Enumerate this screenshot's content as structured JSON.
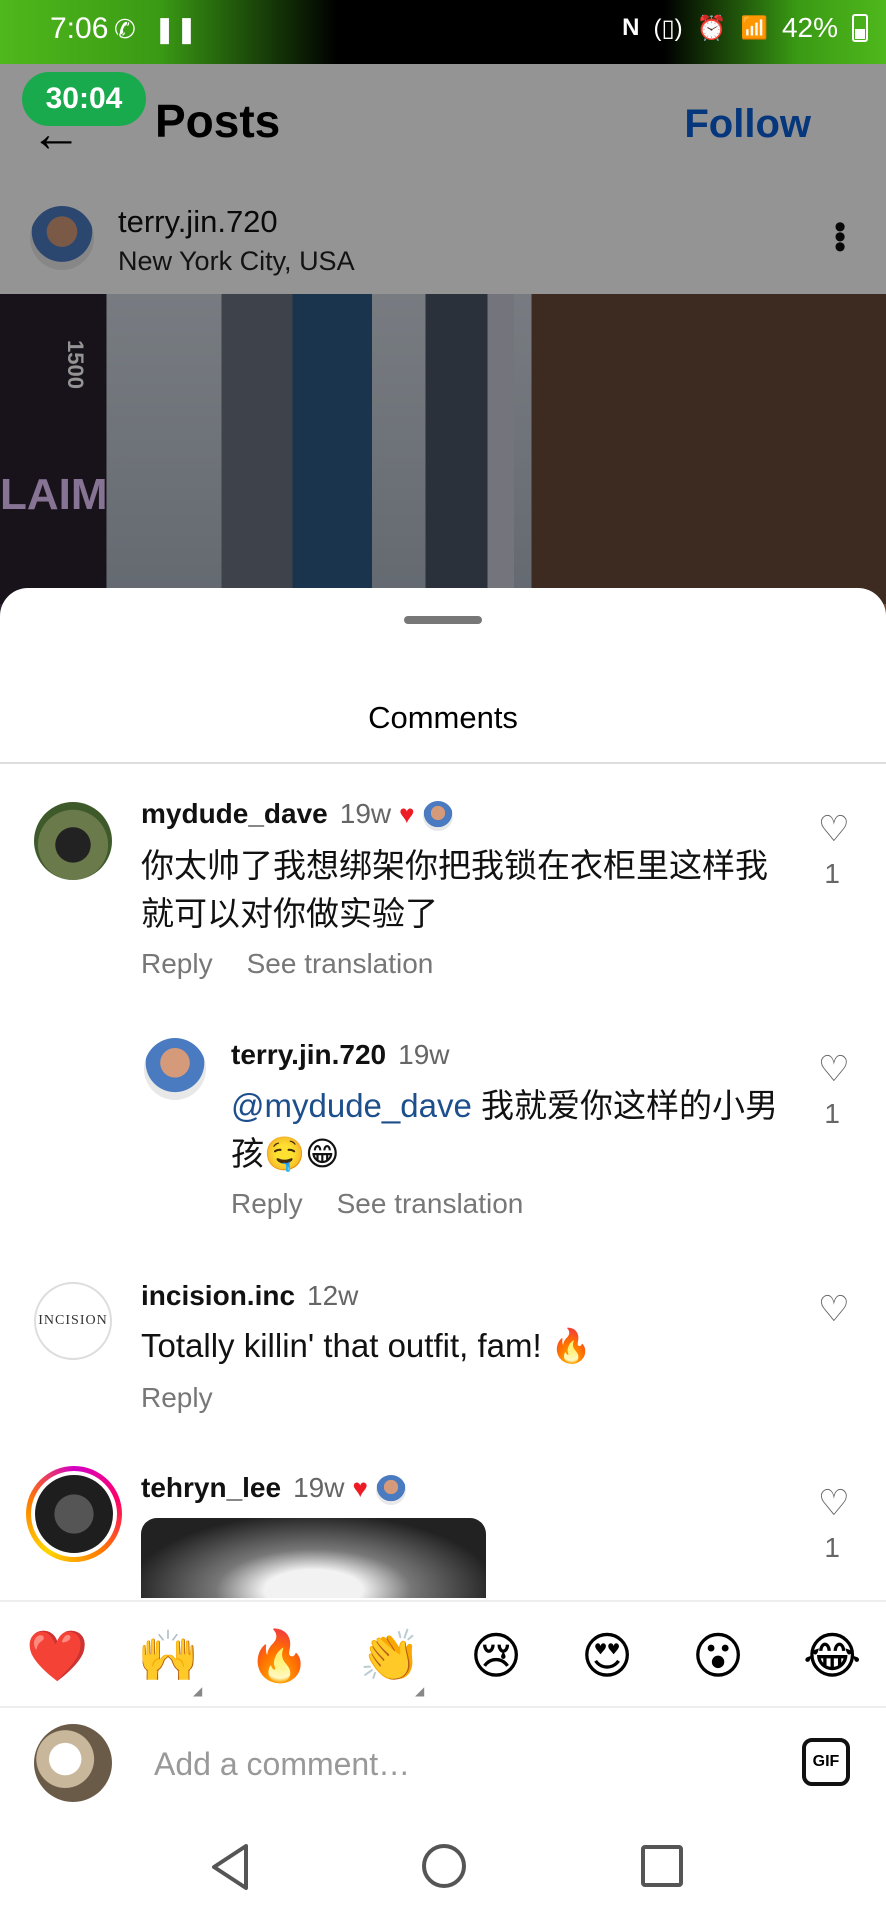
{
  "status_bar": {
    "time": "7:06",
    "battery": "42%",
    "left_icons": [
      "phone-icon",
      "pause-icon"
    ],
    "right_icons": [
      "nfc-icon",
      "vibrate-icon",
      "alarm-icon",
      "wifi-icon",
      "signal-icon",
      "battery-icon"
    ]
  },
  "timer": "30:04",
  "post_header": {
    "title": "Posts",
    "follow_label": "Follow",
    "username": "terry.jin.720",
    "location": "New York City, USA"
  },
  "post_image": {
    "sign_1500": "1500",
    "sign_claim": "LAIM"
  },
  "sheet": {
    "title": "Comments"
  },
  "comments": [
    {
      "user": "mydude_dave",
      "time": "19w",
      "liked_by_author": true,
      "text": "你太帅了我想绑架你把我锁在衣柜里这样我就可以对你做实验了",
      "reply_label": "Reply",
      "translate_label": "See translation",
      "likes": "1"
    },
    {
      "user": "terry.jin.720",
      "time": "19w",
      "mention": "@mydude_dave",
      "text": " 我就爱你这样的小男孩🤤😁",
      "reply_label": "Reply",
      "translate_label": "See translation",
      "likes": "1"
    },
    {
      "user": "incision.inc",
      "avatar_text": "INCISION",
      "time": "12w",
      "text": "Totally killin' that outfit, fam! 🔥",
      "reply_label": "Reply",
      "likes": ""
    },
    {
      "user": "tehryn_lee",
      "time": "19w",
      "liked_by_author": true,
      "likes": "1"
    }
  ],
  "emoji_bar": [
    "❤️",
    "🙌",
    "🔥",
    "👏",
    "😢",
    "😍",
    "😮",
    "😂"
  ],
  "compose": {
    "placeholder": "Add a comment…",
    "gif_label": "GIF"
  },
  "colors": {
    "follow_blue": "#0b5fd6",
    "timer_green": "#1aaa4e",
    "heart_red": "#ed1c24",
    "mention_blue": "#1d4f8c"
  }
}
